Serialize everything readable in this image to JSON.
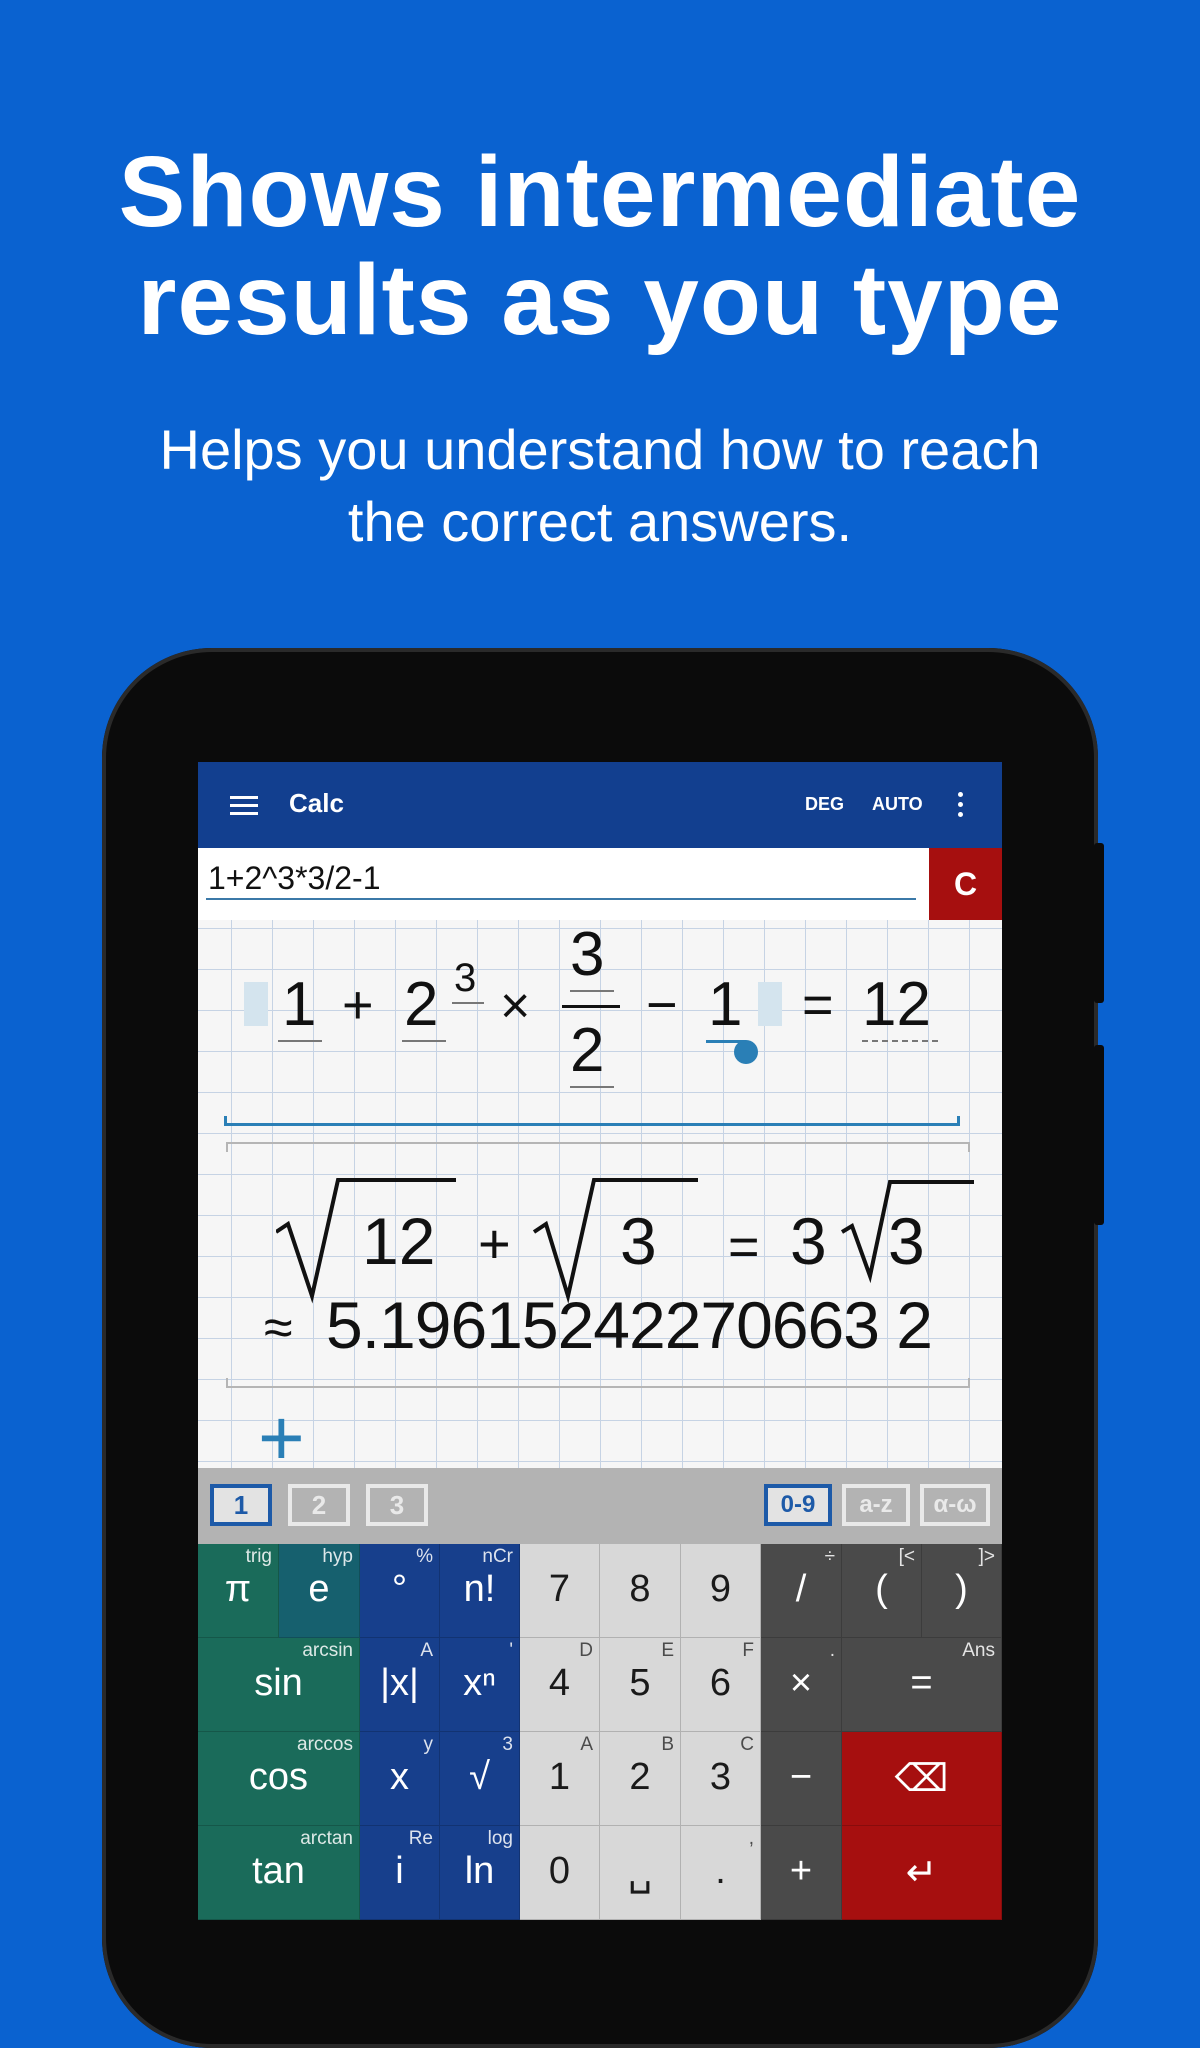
{
  "promo": {
    "headline_line1": "Shows intermediate",
    "headline_line2": "results as you type",
    "subline_line1": "Helps you understand how to reach",
    "subline_line2": "the correct answers."
  },
  "appbar": {
    "title": "Calc",
    "angle_mode": "DEG",
    "format_mode": "AUTO"
  },
  "input": {
    "value": "1+2^3*3/2-1",
    "clear_label": "C"
  },
  "expression1": {
    "t1": "1",
    "op_plus": "+",
    "base": "2",
    "exp": "3",
    "op_times": "×",
    "numerator": "3",
    "denominator": "2",
    "op_minus": "−",
    "t_last": "1",
    "eq": "=",
    "result": "12"
  },
  "expression2": {
    "rad1": "12",
    "op_plus": "+",
    "rad2": "3",
    "eq": "=",
    "coef": "3",
    "rad3": "3",
    "approx_sign": "≈",
    "approx_value": "5.19615242270663 2"
  },
  "add_label": "+",
  "keyboard": {
    "pages": [
      "1",
      "2",
      "3"
    ],
    "modes": [
      "0-9",
      "a-z",
      "α-ω"
    ],
    "rows": [
      [
        {
          "label": "π",
          "sup": "trig"
        },
        {
          "label": "e",
          "sup": "hyp"
        },
        {
          "label": "°",
          "sup": "%"
        },
        {
          "label": "n!",
          "sup": "nCr"
        },
        {
          "label": "7",
          "sup": ""
        },
        {
          "label": "8",
          "sup": ""
        },
        {
          "label": "9",
          "sup": ""
        },
        {
          "label": "/",
          "sup": "÷"
        },
        {
          "label": "(",
          "sup": "[<"
        },
        {
          "label": ")",
          "sup": "]>"
        }
      ],
      [
        {
          "label": "sin",
          "sup": "arcsin"
        },
        {
          "label": "|x|",
          "sup": "A"
        },
        {
          "label": "xⁿ",
          "sup": "'"
        },
        {
          "label": "4",
          "sup": "D"
        },
        {
          "label": "5",
          "sup": "E"
        },
        {
          "label": "6",
          "sup": "F"
        },
        {
          "label": "×",
          "sup": "."
        },
        {
          "label": "=",
          "sup": "Ans"
        }
      ],
      [
        {
          "label": "cos",
          "sup": "arccos"
        },
        {
          "label": "x",
          "sup": "y"
        },
        {
          "label": "√",
          "sup": "3"
        },
        {
          "label": "1",
          "sup": "A"
        },
        {
          "label": "2",
          "sup": "B"
        },
        {
          "label": "3",
          "sup": "C"
        },
        {
          "label": "−",
          "sup": ""
        },
        {
          "label": "⌫",
          "sup": ""
        }
      ],
      [
        {
          "label": "tan",
          "sup": "arctan"
        },
        {
          "label": "i",
          "sup": "Re"
        },
        {
          "label": "ln",
          "sup": "log"
        },
        {
          "label": "0",
          "sup": ""
        },
        {
          "label": "␣",
          "sup": ""
        },
        {
          "label": ".",
          "sup": ","
        },
        {
          "label": "+",
          "sup": ""
        },
        {
          "label": "↵",
          "sup": ""
        }
      ]
    ]
  },
  "colors": {
    "background": "#0a62d0",
    "appbar": "#123f8f",
    "clear": "#a60f0f",
    "func_green": "#1a6b5a",
    "func_blue": "#173f8c",
    "num_key": "#d8d8d8",
    "op_key": "#4a4a4a"
  }
}
